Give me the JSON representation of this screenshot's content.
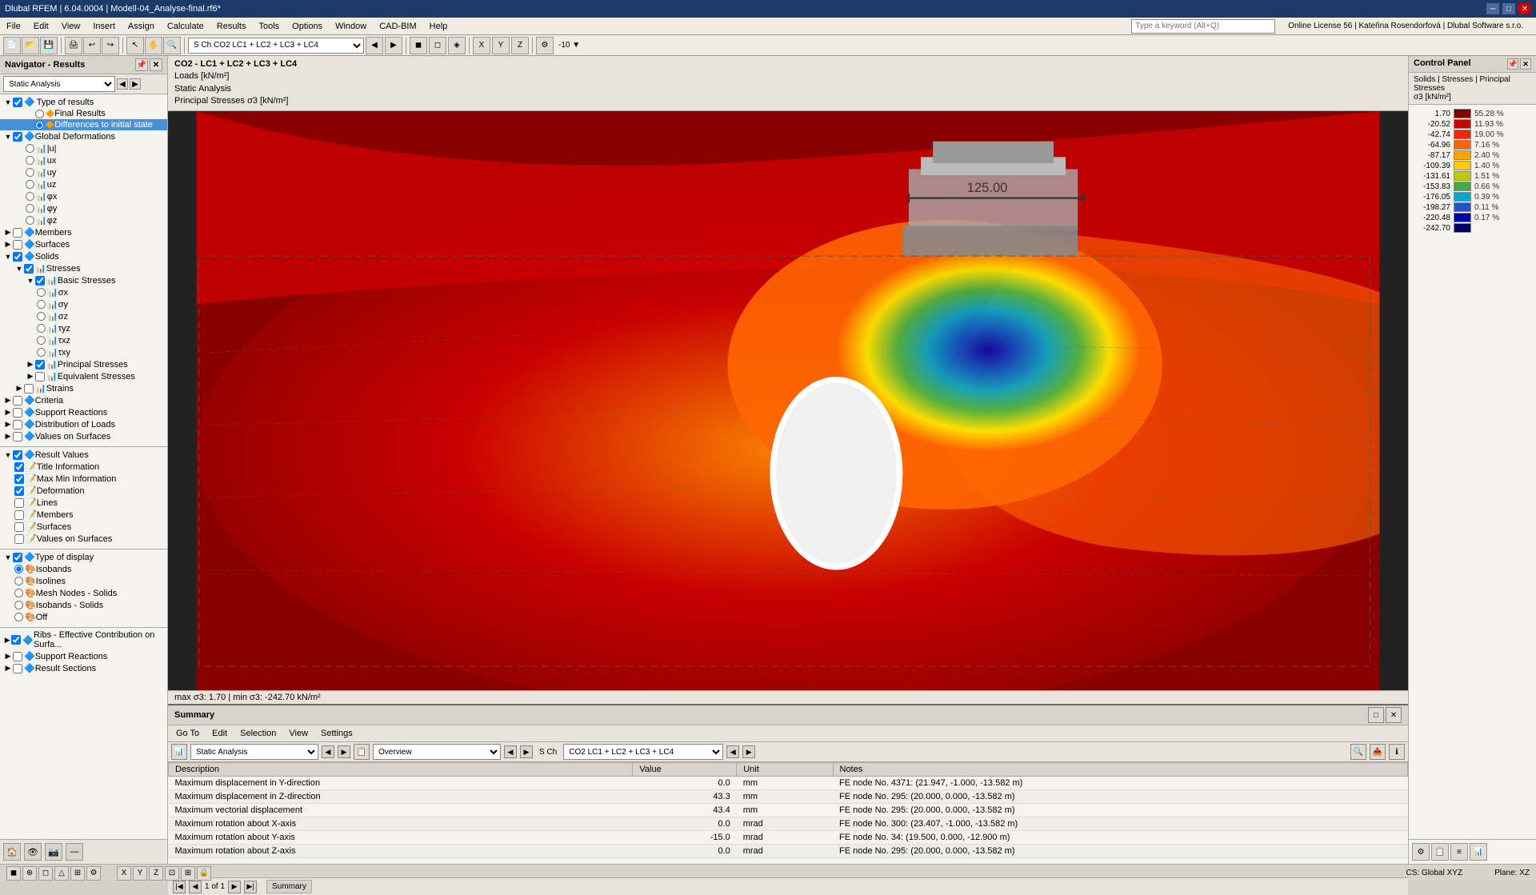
{
  "titlebar": {
    "title": "Dlubal RFEM | 6.04.0004 | Modell-04_Analyse-final.rf6*",
    "win_min": "─",
    "win_max": "□",
    "win_close": "✕"
  },
  "menubar": {
    "items": [
      "File",
      "Edit",
      "View",
      "Insert",
      "Assign",
      "Calculate",
      "Results",
      "Tools",
      "Options",
      "Window",
      "CAD-BIM",
      "Help"
    ]
  },
  "search_placeholder": "Type a keyword (Alt+Q)",
  "license_info": "Online License 56 | Kateřina Rosendorfová | Dlubal Software s.r.o.",
  "navigator": {
    "title": "Navigator - Results",
    "dropdown_value": "Static Analysis",
    "sections": {
      "type_of_results": {
        "label": "Type of results",
        "expanded": true,
        "children": [
          "Final Results",
          "Differences to initial state"
        ]
      },
      "global_deformations": {
        "label": "Global Deformations",
        "expanded": true,
        "children": [
          "|u|",
          "ux",
          "uy",
          "uz",
          "φx",
          "φy",
          "φz"
        ]
      },
      "members": {
        "label": "Members"
      },
      "surfaces": {
        "label": "Surfaces"
      },
      "solids": {
        "label": "Solids",
        "expanded": true,
        "children": {
          "stresses": {
            "label": "Stresses",
            "expanded": true,
            "children": {
              "basic_stresses": {
                "label": "Basic Stresses",
                "expanded": true,
                "children": [
                  "σx",
                  "σy",
                  "σz",
                  "τyz",
                  "τxz",
                  "τxy"
                ]
              },
              "principal_stresses": {
                "label": "Principal Stresses"
              },
              "equivalent_stresses": {
                "label": "Equivalent Stresses"
              }
            }
          },
          "strains": {
            "label": "Strains"
          }
        }
      },
      "criteria": {
        "label": "Criteria"
      },
      "support_reactions": {
        "label": "Support Reactions"
      },
      "distribution_of_loads": {
        "label": "Distribution of Loads"
      },
      "values_on_surfaces": {
        "label": "Values on Surfaces"
      }
    },
    "result_values": {
      "label": "Result Values",
      "children": {
        "title_information": {
          "label": "Title Information",
          "checked": true
        },
        "maxmin_information": {
          "label": "Max Min Information",
          "checked": true
        },
        "deformation": {
          "label": "Deformation",
          "checked": true
        },
        "lines": {
          "label": "Lines",
          "checked": false
        },
        "members": {
          "label": "Members",
          "checked": false
        },
        "surfaces": {
          "label": "Surfaces",
          "checked": false
        },
        "values_on_surfaces": {
          "label": "Values on Surfaces",
          "checked": false
        }
      }
    },
    "type_of_display": {
      "label": "Type of display",
      "options": {
        "isobands": {
          "label": "Isobands",
          "selected": true
        },
        "isolines": {
          "label": "Isolines",
          "selected": false
        },
        "mesh_nodes_solids": {
          "label": "Mesh Nodes - Solids",
          "selected": false
        },
        "isobands_solids": {
          "label": "Isobands - Solids",
          "selected": false
        },
        "off": {
          "label": "Off",
          "selected": false
        }
      }
    },
    "other": {
      "ribs": {
        "label": "Ribs - Effective Contribution on Surfa..."
      },
      "support_reactions": {
        "label": "Support Reactions"
      },
      "result_sections": {
        "label": "Result Sections"
      }
    }
  },
  "viewport": {
    "header_line1": "CO2 - LC1 + LC2 + LC3 + LC4",
    "header_line2": "Loads [kN/m²]",
    "header_line3": "Static Analysis",
    "header_line4": "Principal Stresses σ3 [kN/m²]",
    "footer": "max σ3: 1.70 | min σ3: -242.70 kN/m²",
    "scale_value": "125.00"
  },
  "control_panel": {
    "title": "Control Panel",
    "subtitle": "Solids | Stresses | Principal Stresses\nσ3 [kN/m²]",
    "legend": [
      {
        "value": "1.70",
        "pct": "55.28 %",
        "color": "#7f0000"
      },
      {
        "value": "-20.52",
        "pct": "11.93 %",
        "color": "#cc0000"
      },
      {
        "value": "-42.74",
        "pct": "19.00 %",
        "color": "#ff2200"
      },
      {
        "value": "-64.96",
        "pct": "7.16 %",
        "color": "#ff6600"
      },
      {
        "value": "-87.17",
        "pct": "2.40 %",
        "color": "#ffa500"
      },
      {
        "value": "-109.39",
        "pct": "1.40 %",
        "color": "#ffcc00"
      },
      {
        "value": "-131.61",
        "pct": "1.51 %",
        "color": "#bbcc00"
      },
      {
        "value": "-153.83",
        "pct": "0.66 %",
        "color": "#44aa44"
      },
      {
        "value": "-176.05",
        "pct": "0.39 %",
        "color": "#00aacc"
      },
      {
        "value": "-198.27",
        "pct": "0.11 %",
        "color": "#2255cc"
      },
      {
        "value": "-220.48",
        "pct": "0.17 %",
        "color": "#0000aa"
      },
      {
        "value": "-242.70",
        "pct": "",
        "color": "#000066"
      }
    ]
  },
  "summary": {
    "title": "Summary",
    "tabs": {
      "goto": "Go To",
      "edit": "Edit",
      "selection": "Selection",
      "view": "View",
      "settings": "Settings"
    },
    "combo1": "Static Analysis",
    "combo2": "Overview",
    "lc_combo": "CO2   LC1 + LC2 + LC3 + LC4",
    "pagination": "1 of 1",
    "tab_label": "Summary",
    "table": {
      "headers": [
        "Description",
        "Value",
        "Unit",
        "Notes"
      ],
      "rows": [
        {
          "description": "Maximum displacement in Y-direction",
          "value": "0.0",
          "unit": "mm",
          "notes": "FE node No. 4371: (21.947, -1.000, -13.582 m)"
        },
        {
          "description": "Maximum displacement in Z-direction",
          "value": "43.3",
          "unit": "mm",
          "notes": "FE node No. 295: (20.000, 0.000, -13.582 m)"
        },
        {
          "description": "Maximum vectorial displacement",
          "value": "43.4",
          "unit": "mm",
          "notes": "FE node No. 295: (20.000, 0.000, -13.582 m)"
        },
        {
          "description": "Maximum rotation about X-axis",
          "value": "0.0",
          "unit": "mrad",
          "notes": "FE node No. 300: (23.407, -1.000, -13.582 m)"
        },
        {
          "description": "Maximum rotation about Y-axis",
          "value": "-15.0",
          "unit": "mrad",
          "notes": "FE node No. 34: (19.500, 0.000, -12.900 m)"
        },
        {
          "description": "Maximum rotation about Z-axis",
          "value": "0.0",
          "unit": "mrad",
          "notes": "FE node No. 295: (20.000, 0.000, -13.582 m)"
        }
      ]
    }
  },
  "statusbar": {
    "cs": "CS: Global XYZ",
    "plane": "Plane: XZ"
  }
}
